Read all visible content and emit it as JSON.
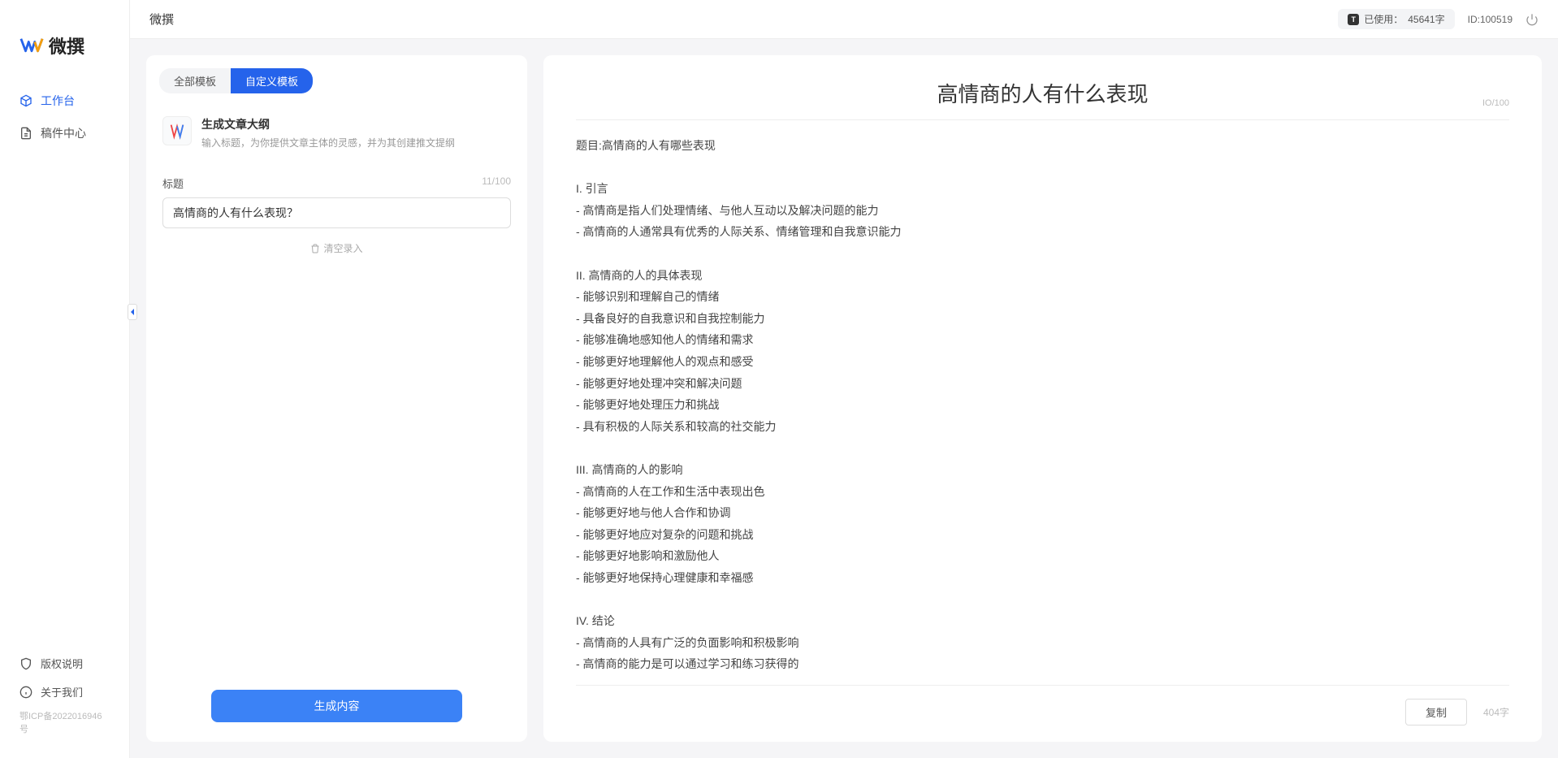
{
  "app_name": "微撰",
  "sidebar": {
    "logo_text": "微撰",
    "nav": [
      {
        "label": "工作台",
        "active": true
      },
      {
        "label": "稿件中心",
        "active": false
      }
    ],
    "footer": [
      {
        "label": "版权说明"
      },
      {
        "label": "关于我们"
      }
    ],
    "icp": "鄂ICP备2022016946号"
  },
  "topbar": {
    "title": "微撰",
    "usage_label": "已使用：",
    "usage_value": "45641字",
    "user_id": "ID:100519"
  },
  "left_panel": {
    "tabs": [
      {
        "label": "全部模板",
        "active": false
      },
      {
        "label": "自定义模板",
        "active": true
      }
    ],
    "template": {
      "title": "生成文章大纲",
      "desc": "输入标题，为你提供文章主体的灵感，并为其创建推文提纲"
    },
    "form": {
      "label": "标题",
      "count": "11/100",
      "value": "高情商的人有什么表现？"
    },
    "clear_text": "清空录入",
    "generate_label": "生成内容"
  },
  "right_panel": {
    "title": "高情商的人有什么表现",
    "io_count": "IO/100",
    "body": "题目:高情商的人有哪些表现\n\nI. 引言\n- 高情商是指人们处理情绪、与他人互动以及解决问题的能力\n- 高情商的人通常具有优秀的人际关系、情绪管理和自我意识能力\n\nII. 高情商的人的具体表现\n- 能够识别和理解自己的情绪\n- 具备良好的自我意识和自我控制能力\n- 能够准确地感知他人的情绪和需求\n- 能够更好地理解他人的观点和感受\n- 能够更好地处理冲突和解决问题\n- 能够更好地处理压力和挑战\n- 具有积极的人际关系和较高的社交能力\n\nIII. 高情商的人的影响\n- 高情商的人在工作和生活中表现出色\n- 能够更好地与他人合作和协调\n- 能够更好地应对复杂的问题和挑战\n- 能够更好地影响和激励他人\n- 能够更好地保持心理健康和幸福感\n\nIV. 结论\n- 高情商的人具有广泛的负面影响和积极影响\n- 高情商的能力是可以通过学习和练习获得的\n- 培养和提高高情商的能力对于个人的职业发展和生活质量至关重要。",
    "copy_label": "复制",
    "char_count": "404字"
  }
}
